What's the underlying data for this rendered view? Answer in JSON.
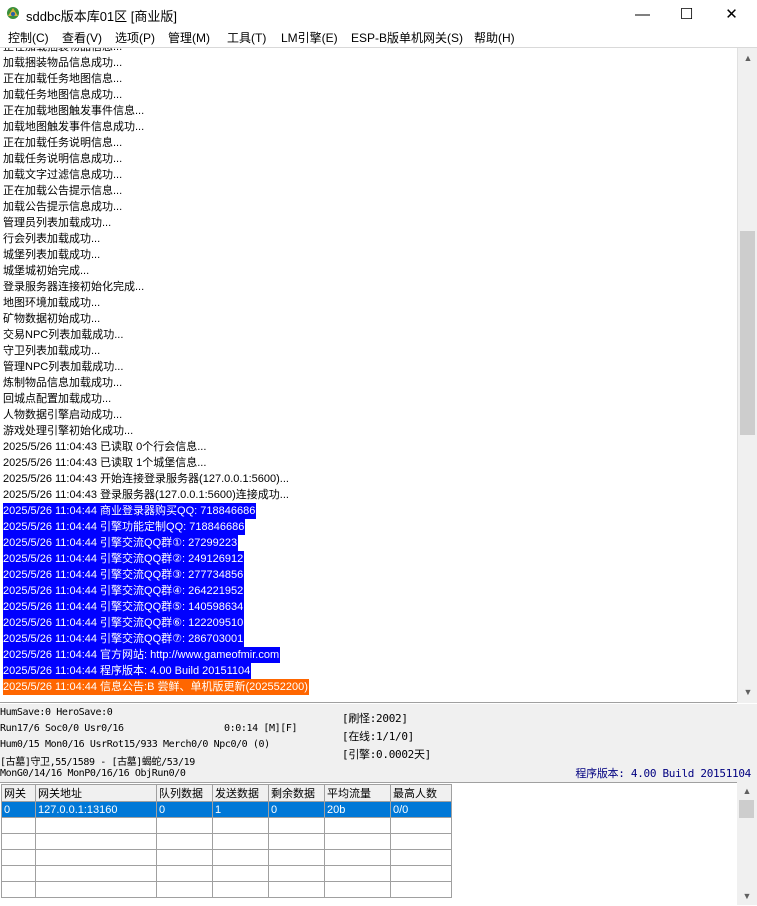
{
  "window": {
    "title": "sddbc版本库01区 [商业版]",
    "min_glyph": "—",
    "max_glyph": "☐",
    "close_glyph": "✕"
  },
  "menu": [
    {
      "label": "控制(C)"
    },
    {
      "label": "查看(V)"
    },
    {
      "label": "选项(P)"
    },
    {
      "label": "管理(M)"
    },
    {
      "label": "工具(T)"
    },
    {
      "label": "LM引擎(E)"
    },
    {
      "label": "ESP-B版单机网关(S)"
    },
    {
      "label": "帮助(H)"
    }
  ],
  "log": [
    {
      "text": "正在加载捆装物品信息...",
      "hl": ""
    },
    {
      "text": "加载捆装物品信息成功...",
      "hl": ""
    },
    {
      "text": "正在加载任务地图信息...",
      "hl": ""
    },
    {
      "text": "加载任务地图信息成功...",
      "hl": ""
    },
    {
      "text": "正在加载地图触发事件信息...",
      "hl": ""
    },
    {
      "text": "加载地图触发事件信息成功...",
      "hl": ""
    },
    {
      "text": "正在加载任务说明信息...",
      "hl": ""
    },
    {
      "text": "加载任务说明信息成功...",
      "hl": ""
    },
    {
      "text": "加载文字过滤信息成功...",
      "hl": ""
    },
    {
      "text": "正在加载公告提示信息...",
      "hl": ""
    },
    {
      "text": "加载公告提示信息成功...",
      "hl": ""
    },
    {
      "text": "管理员列表加载成功...",
      "hl": ""
    },
    {
      "text": "行会列表加载成功...",
      "hl": ""
    },
    {
      "text": "城堡列表加载成功...",
      "hl": ""
    },
    {
      "text": "城堡城初始完成...",
      "hl": ""
    },
    {
      "text": "登录服务器连接初始化完成...",
      "hl": ""
    },
    {
      "text": "地图环境加载成功...",
      "hl": ""
    },
    {
      "text": "矿物数据初始成功...",
      "hl": ""
    },
    {
      "text": "交易NPC列表加载成功...",
      "hl": ""
    },
    {
      "text": "守卫列表加载成功...",
      "hl": ""
    },
    {
      "text": "管理NPC列表加载成功...",
      "hl": ""
    },
    {
      "text": "炼制物品信息加载成功...",
      "hl": ""
    },
    {
      "text": "回城点配置加载成功...",
      "hl": ""
    },
    {
      "text": "人物数据引擎启动成功...",
      "hl": ""
    },
    {
      "text": "游戏处理引擎初始化成功...",
      "hl": ""
    },
    {
      "text": "2025/5/26 11:04:43 已读取 0个行会信息...",
      "hl": ""
    },
    {
      "text": "2025/5/26 11:04:43 已读取 1个城堡信息...",
      "hl": ""
    },
    {
      "text": "2025/5/26 11:04:43 开始连接登录服务器(127.0.0.1:5600)...",
      "hl": ""
    },
    {
      "text": "2025/5/26 11:04:43 登录服务器(127.0.0.1:5600)连接成功...",
      "hl": ""
    },
    {
      "text": "2025/5/26 11:04:44 商业登录器购买QQ: 718846686",
      "hl": "blue"
    },
    {
      "text": "2025/5/26 11:04:44 引擎功能定制QQ: 718846686",
      "hl": "blue"
    },
    {
      "text": "2025/5/26 11:04:44 引擎交流QQ群①: 27299223",
      "hl": "blue"
    },
    {
      "text": "2025/5/26 11:04:44 引擎交流QQ群②: 249126912",
      "hl": "blue"
    },
    {
      "text": "2025/5/26 11:04:44 引擎交流QQ群③: 277734856",
      "hl": "blue"
    },
    {
      "text": "2025/5/26 11:04:44 引擎交流QQ群④: 264221952",
      "hl": "blue"
    },
    {
      "text": "2025/5/26 11:04:44 引擎交流QQ群⑤: 140598634",
      "hl": "blue"
    },
    {
      "text": "2025/5/26 11:04:44 引擎交流QQ群⑥: 122209510",
      "hl": "blue"
    },
    {
      "text": "2025/5/26 11:04:44 引擎交流QQ群⑦: 286703001",
      "hl": "blue"
    },
    {
      "text": "2025/5/26 11:04:44 官方网站: http://www.gameofmir.com",
      "hl": "blue"
    },
    {
      "text": "2025/5/26 11:04:44 程序版本: 4.00 Build 20151104",
      "hl": "blue"
    },
    {
      "text": "2025/5/26 11:04:44 信息公告:B 尝鲜、单机版更新(202552200)",
      "hl": "orange"
    }
  ],
  "status": {
    "line1": "HumSave:0 HeroSave:0",
    "line2": "Run17/6 Soc0/0 Usr0/16",
    "line2_time": "0:0:14 [M][F]",
    "line3": "Hum0/15 Mon0/16 UsrRot15/933 Merch0/0 Npc0/0 (0)",
    "line4": "[古墓]守卫,55/1589 - [古墓]蝎蛇/53/19",
    "line5": "MonG0/14/16 MonP0/16/16 ObjRun0/0",
    "refresh": "[刷怪:2002]",
    "online": "[在线:1/1/0]",
    "engine": "[引擎:0.0002天]",
    "version": "程序版本: 4.00 Build 20151104"
  },
  "grid": {
    "headers": [
      "网关",
      "网关地址",
      "队列数据",
      "发送数据",
      "剩余数据",
      "平均流量",
      "最高人数"
    ],
    "rows": [
      [
        "0",
        "127.0.0.1:13160",
        "0",
        "1",
        "0",
        "20b",
        "0/0"
      ]
    ]
  },
  "colors": {
    "highlight_blue": "#0000ff",
    "highlight_orange": "#ff6600",
    "selection": "#0078d7"
  }
}
